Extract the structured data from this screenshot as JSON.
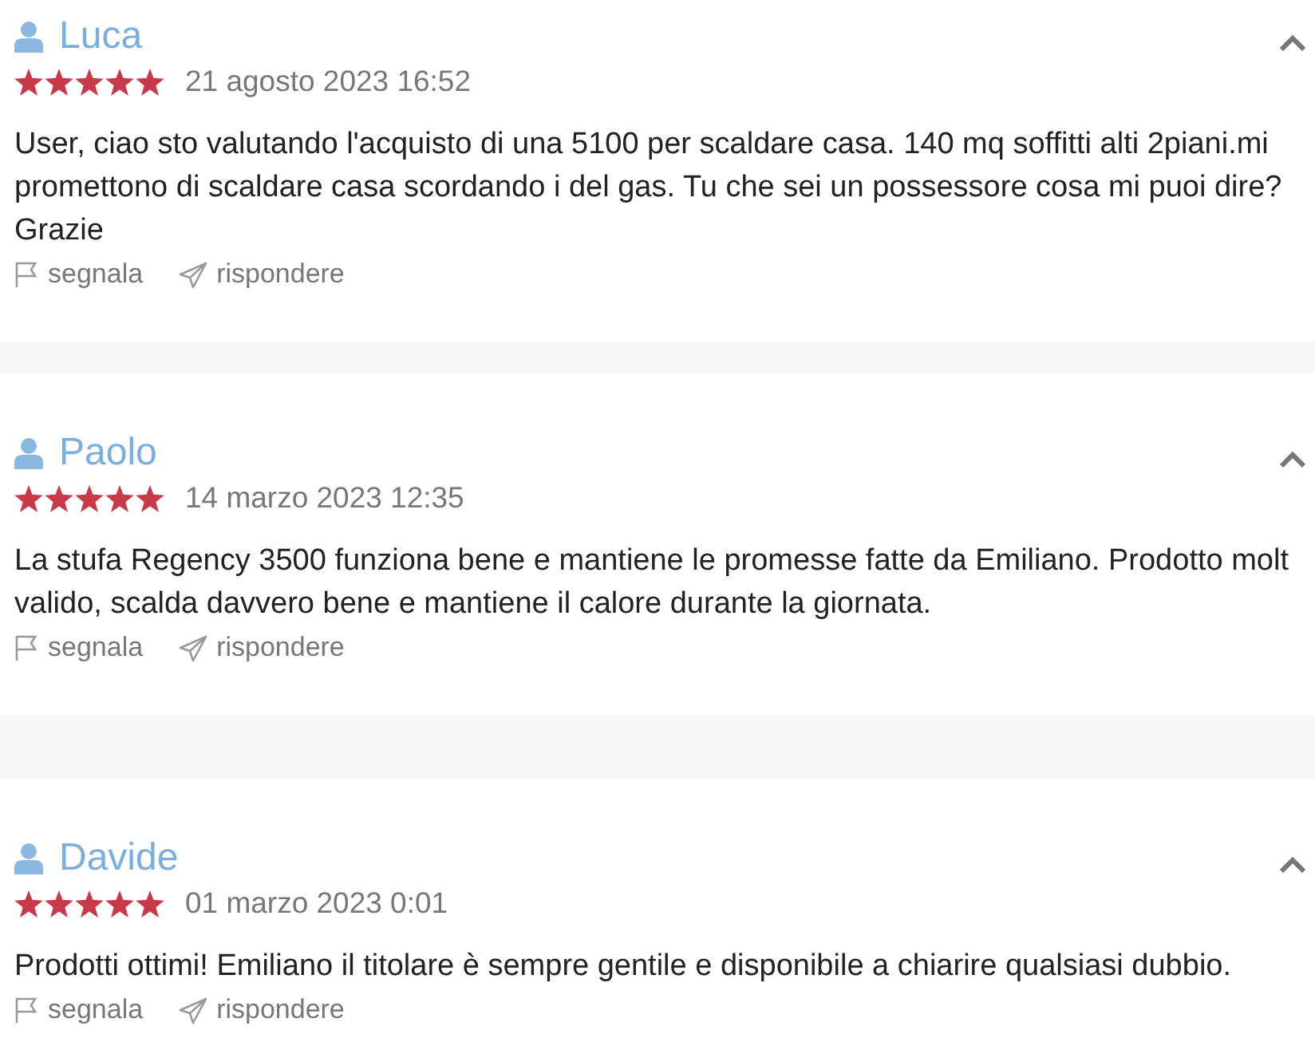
{
  "reviews": [
    {
      "author": "Luca",
      "stars": 5,
      "date": "21 agosto 2023 16:52",
      "lines": [
        "User, ciao sto valutando l'acquisto di una 5100 per scaldare casa. 140 mq soffitti alti 2piani.mi",
        "promettono di scaldare casa scordando i del gas. Tu che sei un possessore cosa mi puoi dire?",
        "Grazie"
      ],
      "report": "segnala",
      "reply": "rispondere"
    },
    {
      "author": "Paolo",
      "stars": 5,
      "date": "14 marzo 2023 12:35",
      "lines": [
        "La stufa Regency 3500 funziona bene e mantiene le promesse fatte da Emiliano. Prodotto molt",
        "valido, scalda davvero bene e mantiene il calore durante la giornata."
      ],
      "report": "segnala",
      "reply": "rispondere"
    },
    {
      "author": "Davide",
      "stars": 5,
      "date": "01 marzo 2023 0:01",
      "lines": [
        "Prodotti ottimi! Emiliano il titolare è sempre gentile e disponibile a chiarire qualsiasi dubbio."
      ],
      "report": "segnala",
      "reply": "rispondere"
    }
  ]
}
